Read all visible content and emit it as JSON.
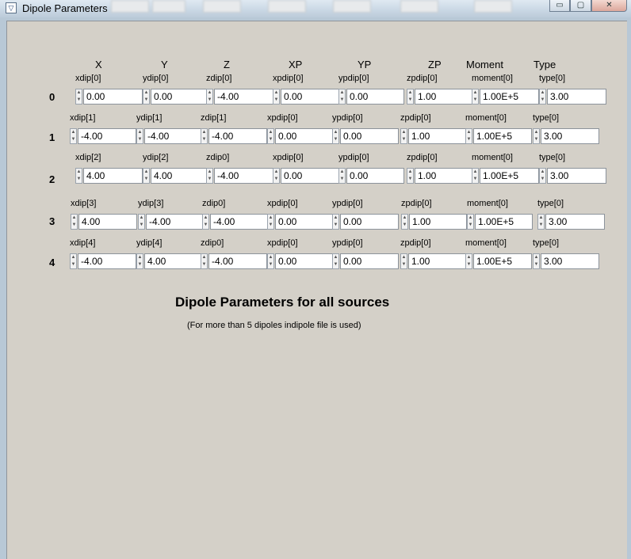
{
  "window": {
    "title": "Dipole Parameters"
  },
  "titlebar_buttons": {
    "minimize": "▭",
    "maximize": "▢",
    "close": "✕"
  },
  "headers": [
    "X",
    "Y",
    "Z",
    "XP",
    "YP",
    "ZP",
    "Moment",
    "Type"
  ],
  "rows": [
    {
      "index": "0",
      "labels": [
        "xdip[0]",
        "ydip[0]",
        "zdip[0]",
        "xpdip[0]",
        "ypdip[0]",
        "zpdip[0]",
        "moment[0]",
        "type[0]"
      ],
      "values": [
        "0.00",
        "0.00",
        "-4.00",
        "0.00",
        "0.00",
        "1.00",
        "1.00E+5",
        "3.00"
      ]
    },
    {
      "index": "1",
      "labels": [
        "xdip[1]",
        "ydip[1]",
        "zdip[1]",
        "xpdip[0]",
        "ypdip[0]",
        "zpdip[0]",
        "moment[0]",
        "type[0]"
      ],
      "values": [
        "-4.00",
        "-4.00",
        "-4.00",
        "0.00",
        "0.00",
        "1.00",
        "1.00E+5",
        "3.00"
      ]
    },
    {
      "index": "2",
      "labels": [
        "xdip[2]",
        "ydip[2]",
        "zdip0]",
        "xpdip[0]",
        "ypdip[0]",
        "zpdip[0]",
        "moment[0]",
        "type[0]"
      ],
      "values": [
        "4.00",
        "4.00",
        "-4.00",
        "0.00",
        "0.00",
        "1.00",
        "1.00E+5",
        "3.00"
      ]
    },
    {
      "index": "3",
      "labels": [
        "xdip[3]",
        "ydip[3]",
        "zdip0]",
        "xpdip[0]",
        "ypdip[0]",
        "zpdip[0]",
        "moment[0]",
        "type[0]"
      ],
      "values": [
        "4.00",
        "-4.00",
        "-4.00",
        "0.00",
        "0.00",
        "1.00",
        "1.00E+5",
        "3.00"
      ]
    },
    {
      "index": "4",
      "labels": [
        "xdip[4]",
        "ydip[4]",
        "zdip0]",
        "xpdip[0]",
        "ypdip[0]",
        "zpdip[0]",
        "moment[0]",
        "type[0]"
      ],
      "values": [
        "-4.00",
        "4.00",
        "-4.00",
        "0.00",
        "0.00",
        "1.00",
        "1.00E+5",
        "3.00"
      ]
    }
  ],
  "footer": {
    "title": "Dipole Parameters for all sources",
    "note": "(For more than 5 dipoles indipole file is used)"
  }
}
